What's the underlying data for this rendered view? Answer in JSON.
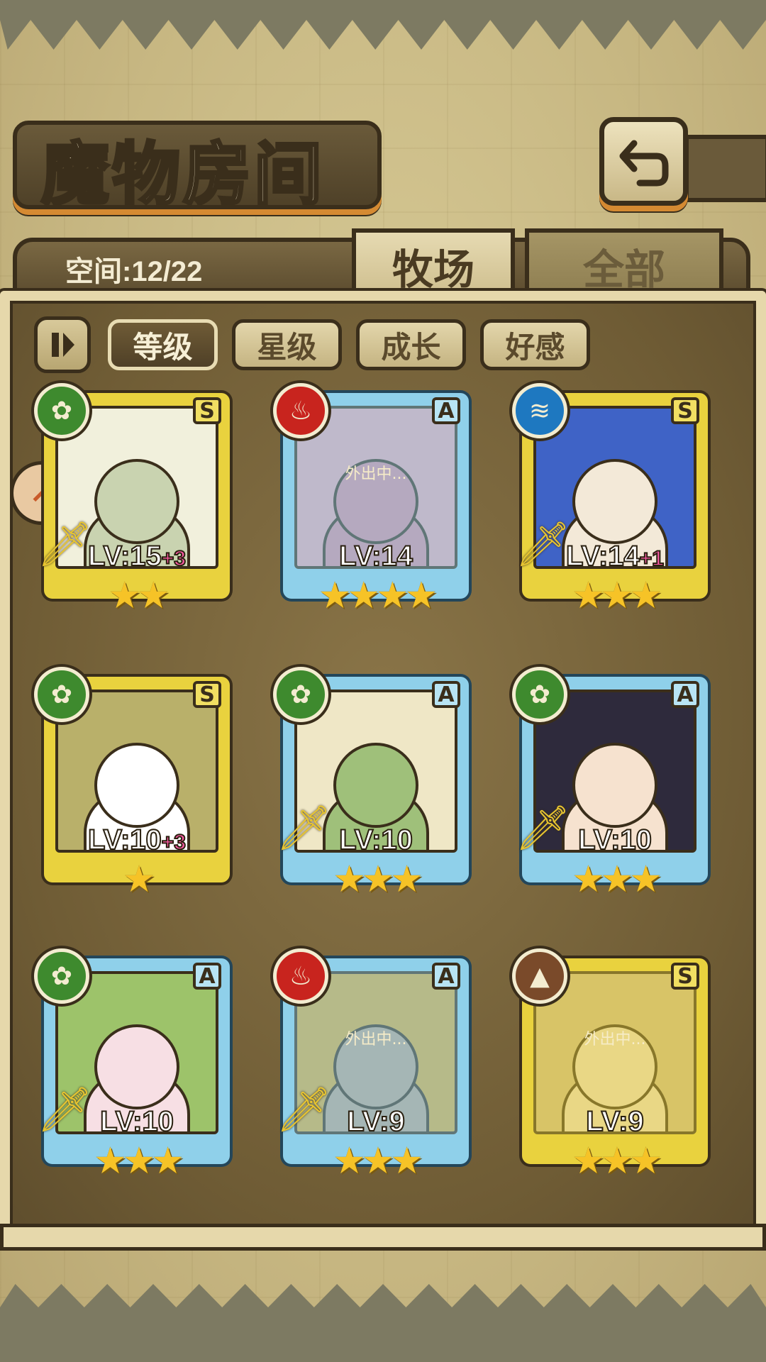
{
  "title": "魔物房间",
  "capacity": "空间:12/22",
  "tabs": [
    {
      "label": "牧场",
      "active": true
    },
    {
      "label": "全部",
      "active": false
    }
  ],
  "sort_buttons": [
    {
      "label": "等级",
      "active": true
    },
    {
      "label": "星级",
      "active": false
    },
    {
      "label": "成长",
      "active": false
    },
    {
      "label": "好感",
      "active": false
    }
  ],
  "monsters": [
    {
      "rank": "S",
      "element": "grass",
      "level": "LV:15",
      "bonus": "+3",
      "stars": "★★",
      "away": "",
      "weapon": true,
      "portrait_hue": "#f1f0dc",
      "accent": "#c9d3b0"
    },
    {
      "rank": "A",
      "element": "fire",
      "level": "LV:14",
      "bonus": "",
      "stars": "★★★★",
      "away": "外出中...",
      "weapon": false,
      "portrait_hue": "#e7a7b3",
      "accent": "#d48a9c"
    },
    {
      "rank": "S",
      "element": "water",
      "level": "LV:14",
      "bonus": "+1",
      "stars": "★★★",
      "away": "",
      "weapon": true,
      "portrait_hue": "#3f63c6",
      "accent": "#f3e9d8"
    },
    {
      "rank": "S",
      "element": "grass",
      "level": "LV:10",
      "bonus": "+3",
      "stars": "★",
      "away": "",
      "weapon": false,
      "portrait_hue": "#b9b06a",
      "accent": "#ffffff"
    },
    {
      "rank": "A",
      "element": "grass",
      "level": "LV:10",
      "bonus": "",
      "stars": "★★★",
      "away": "",
      "weapon": true,
      "portrait_hue": "#efe7c6",
      "accent": "#9fc07a"
    },
    {
      "rank": "A",
      "element": "grass",
      "level": "LV:10",
      "bonus": "",
      "stars": "★★★",
      "away": "",
      "weapon": true,
      "portrait_hue": "#2e2a3c",
      "accent": "#f6e2cf"
    },
    {
      "rank": "A",
      "element": "grass",
      "level": "LV:10",
      "bonus": "",
      "stars": "★★★",
      "away": "",
      "weapon": true,
      "portrait_hue": "#9dc36a",
      "accent": "#f7dfe4"
    },
    {
      "rank": "A",
      "element": "fire",
      "level": "LV:9",
      "bonus": "",
      "stars": "★★★",
      "away": "外出中...",
      "weapon": true,
      "portrait_hue": "#d6a93a",
      "accent": "#b8a18a"
    },
    {
      "rank": "S",
      "element": "earth",
      "level": "LV:9",
      "bonus": "",
      "stars": "★★★",
      "away": "外出中...",
      "weapon": false,
      "portrait_hue": "#cbb98a",
      "accent": "#e9dcc0"
    }
  ],
  "icons": {
    "back": "back-arrow-icon",
    "sort_toggle": "pause-sort-icon",
    "side_tag": "favorite-tag-icon"
  },
  "colors": {
    "rank_S": "#e9d23e",
    "rank_A": "#8fd0ea",
    "grass": "#3e8a2e",
    "fire": "#c8241e",
    "water": "#1e78c0",
    "earth": "#7a4a2a"
  }
}
